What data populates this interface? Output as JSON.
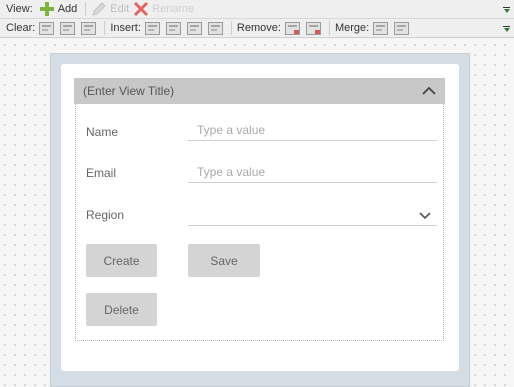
{
  "toolbar1": {
    "view_label": "View:",
    "add_label": "Add",
    "edit_label": "Edit",
    "rename_label": "Rename"
  },
  "toolbar2": {
    "clear_label": "Clear:",
    "insert_label": "Insert:",
    "remove_label": "Remove:",
    "merge_label": "Merge:"
  },
  "view": {
    "title_placeholder": "(Enter View Title)"
  },
  "form": {
    "name_label": "Name",
    "name_placeholder": "Type a value",
    "email_label": "Email",
    "email_placeholder": "Type a value",
    "region_label": "Region",
    "region_value": "",
    "create_label": "Create",
    "save_label": "Save",
    "delete_label": "Delete"
  },
  "colors": {
    "add_icon": "#7cb342",
    "delete_icon": "#e06666",
    "collapse_arrow": "#2e7d32",
    "header_bg": "#c8c8c8",
    "button_bg": "#d4d4d4"
  }
}
